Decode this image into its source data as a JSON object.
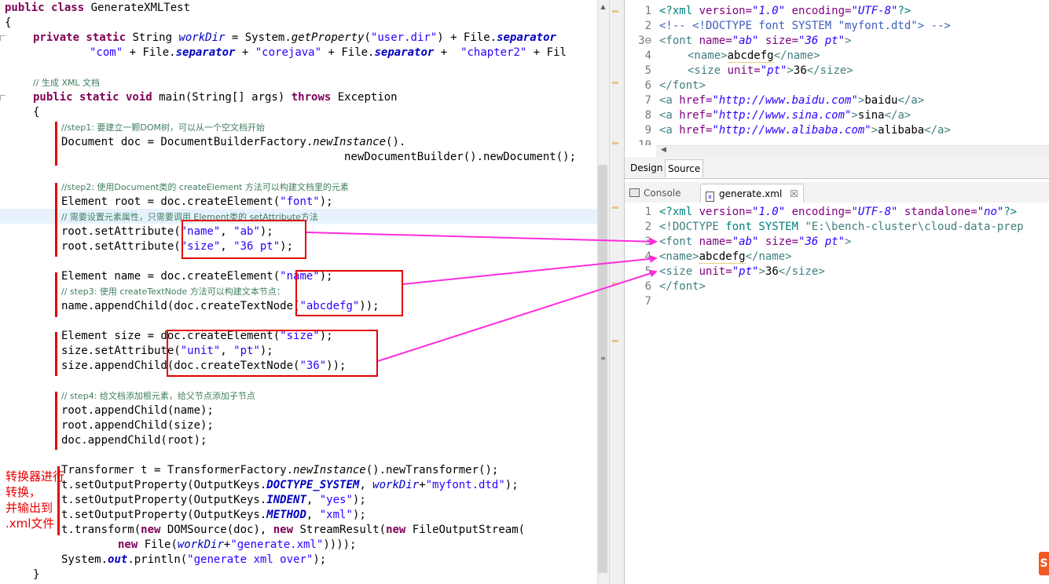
{
  "java": {
    "l1_kw": "public class",
    "l1_name": " GenerateXMLTest",
    "l2": "{",
    "l3_kw": "private static",
    "l3_type": " String ",
    "l3_var": "workDir",
    "l3_a": " = System.",
    "l3_m": "getProperty",
    "l3_b": "(",
    "l3_s": "\"user.dir\"",
    "l3_c": ") + File.",
    "l3_f": "separator",
    "l4_s1": "\"com\"",
    "l4_a": " + File.",
    "l4_f1": "separator",
    "l4_b": " + ",
    "l4_s2": "\"corejava\"",
    "l4_c": " + File.",
    "l4_f2": "separator",
    "l4_d": " +  ",
    "l4_s3": "\"chapter2\"",
    "l4_e": " + Fil",
    "l5": "// 生成 XML 文档",
    "l6_kw": "public static void",
    "l6_a": " main(String[] args) ",
    "l6_kw2": "throws",
    "l6_b": " Exception",
    "l7": "{",
    "l8": "//step1: 要建立一颗DOM树，可以从一个空文档开始",
    "l9_a": "Document doc = DocumentBuilderFactory.",
    "l9_m": "newInstance",
    "l9_b": "().",
    "l10": "newDocumentBuilder().newDocument();",
    "l11": "//step2: 使用Document类的 createElement 方法可以构建文档里的元素",
    "l12_a": "Element root = doc.createElement(",
    "l12_s": "\"font\"",
    "l12_b": ");",
    "l13": "// 需要设置元素属性，只需要调用 Element类的 setAttribute方法",
    "l14_a": "root.setAttribute(",
    "l14_s1": "\"name\"",
    "l14_b": ", ",
    "l14_s2": "\"ab\"",
    "l14_c": ");",
    "l15_a": "root.setAttribute(",
    "l15_s1": "\"size\"",
    "l15_b": ", ",
    "l15_s2": "\"36 pt\"",
    "l15_c": ");",
    "l16_a": "Element name = doc.createElement(",
    "l16_s": "\"name\"",
    "l16_b": ");",
    "l17": "// step3: 使用 createTextNode 方法可以构建文本节点：",
    "l18_a": "name.appendChild(doc.createTextNode(",
    "l18_s": "\"abcdefg\"",
    "l18_b": "));",
    "l19_a": "Element size = doc.createElement(",
    "l19_s": "\"size\"",
    "l19_b": ");",
    "l20_a": "size.setAttribute(",
    "l20_s1": "\"unit\"",
    "l20_b": ", ",
    "l20_s2": "\"pt\"",
    "l20_c": ");",
    "l21_a": "size.appendChild(doc.createTextNode(",
    "l21_s": "\"36\"",
    "l21_b": "));",
    "l22": "// step4: 给文档添加根元素，给父节点添加子节点",
    "l23": "root.appendChild(name);",
    "l24": "root.appendChild(size);",
    "l25": "doc.appendChild(root);",
    "l26_a": "Transformer t = TransformerFactory.",
    "l26_m": "newInstance",
    "l26_b": "().newTransformer();",
    "l27_a": "t.setOutputProperty(OutputKeys.",
    "l27_f": "DOCTYPE_SYSTEM",
    "l27_b": ", ",
    "l27_v": "workDir",
    "l27_c": "+",
    "l27_s": "\"myfont.dtd\"",
    "l27_d": ");",
    "l28_a": "t.setOutputProperty(OutputKeys.",
    "l28_f": "INDENT",
    "l28_b": ", ",
    "l28_s": "\"yes\"",
    "l28_c": ");",
    "l29_a": "t.setOutputProperty(OutputKeys.",
    "l29_f": "METHOD",
    "l29_b": ", ",
    "l29_s": "\"xml\"",
    "l29_c": ");",
    "l30_a": "t.transform(",
    "l30_kw": "new",
    "l30_b": " DOMSource(doc), ",
    "l30_kw2": "new",
    "l30_c": " StreamResult(",
    "l30_kw3": "new",
    "l30_d": " FileOutputStream(",
    "l31_kw": "new",
    "l31_a": " File(",
    "l31_v": "workDir",
    "l31_b": "+",
    "l31_s": "\"generate.xml\"",
    "l31_c": "))));",
    "l32_a": "System.",
    "l32_f": "out",
    "l32_b": ".println(",
    "l32_s": "\"generate xml over\"",
    "l32_c": ");",
    "l33": "}"
  },
  "annotation": [
    "转换器进行",
    "转换，",
    "并输出到",
    ".xml文件"
  ],
  "xml_top": {
    "line_numbers": [
      "1",
      "2",
      "3⊖",
      "4",
      "5",
      "6",
      "7",
      "8",
      "9",
      "10"
    ],
    "l1_p": "<?xml",
    "l1_a1": " version=",
    "l1_v1": "\"1.0\"",
    "l1_a2": " encoding=",
    "l1_v2": "\"UTF-8\"",
    "l1_e": "?>",
    "l2": "<!-- <!DOCTYPE font SYSTEM \"myfont.dtd\"> -->",
    "l3_t": "<font",
    "l3_a1": " name=",
    "l3_v1": "\"ab\"",
    "l3_a2": " size=",
    "l3_v2": "\"36 pt\"",
    "l3_e": ">",
    "l4_t": "<name>",
    "l4_x": "abcdefg",
    "l4_e": "</name>",
    "l5_t": "<size",
    "l5_a": " unit=",
    "l5_v": "\"pt\"",
    "l5_g": ">",
    "l5_x": "36",
    "l5_e": "</size>",
    "l6": "</font>",
    "l7_t": "<a",
    "l7_a": " href=",
    "l7_v": "\"http://www.baidu.com\"",
    "l7_g": ">",
    "l7_x": "baidu",
    "l7_e": "</a>",
    "l8_t": "<a",
    "l8_a": " href=",
    "l8_v": "\"http://www.sina.com\"",
    "l8_g": ">",
    "l8_x": "sina",
    "l8_e": "</a>",
    "l9_t": "<a",
    "l9_a": " href=",
    "l9_v": "\"http://www.alibaba.com\"",
    "l9_g": ">",
    "l9_x": "alibaba",
    "l9_e": "</a>"
  },
  "design_tabs": {
    "design": "Design",
    "source": "Source"
  },
  "view_tabs": {
    "console": "Console",
    "file": "generate.xml",
    "close": "☒"
  },
  "xml_bottom": {
    "line_numbers": [
      "1",
      "2",
      "3",
      "4",
      "5",
      "6",
      "7"
    ],
    "l1_p": "<?xml",
    "l1_a1": " version=",
    "l1_v1": "\"1.0\"",
    "l1_a2": " encoding=",
    "l1_v2": "\"UTF-8\"",
    "l1_a3": " standalone=",
    "l1_v3": "\"no\"",
    "l1_e": "?>",
    "l2_a": "<!DOCTYPE",
    "l2_b": " font SYSTEM ",
    "l2_c": "\"E:\\bench-cluster\\cloud-data-prep",
    "l3_t": "<font",
    "l3_a1": " name=",
    "l3_v1": "\"ab\"",
    "l3_a2": " size=",
    "l3_v2": "\"36 pt\"",
    "l3_e": ">",
    "l4_t": "<name>",
    "l4_x": "abcdefg",
    "l4_e": "</name>",
    "l5_t": "<size",
    "l5_a": " unit=",
    "l5_v": "\"pt\"",
    "l5_g": ">",
    "l5_x": "36",
    "l5_e": "</size>",
    "l6": "</font>"
  },
  "colors": {
    "annotation_red": "#e60000",
    "arrow_magenta": "#ff2cdc"
  },
  "logo_text": "S"
}
